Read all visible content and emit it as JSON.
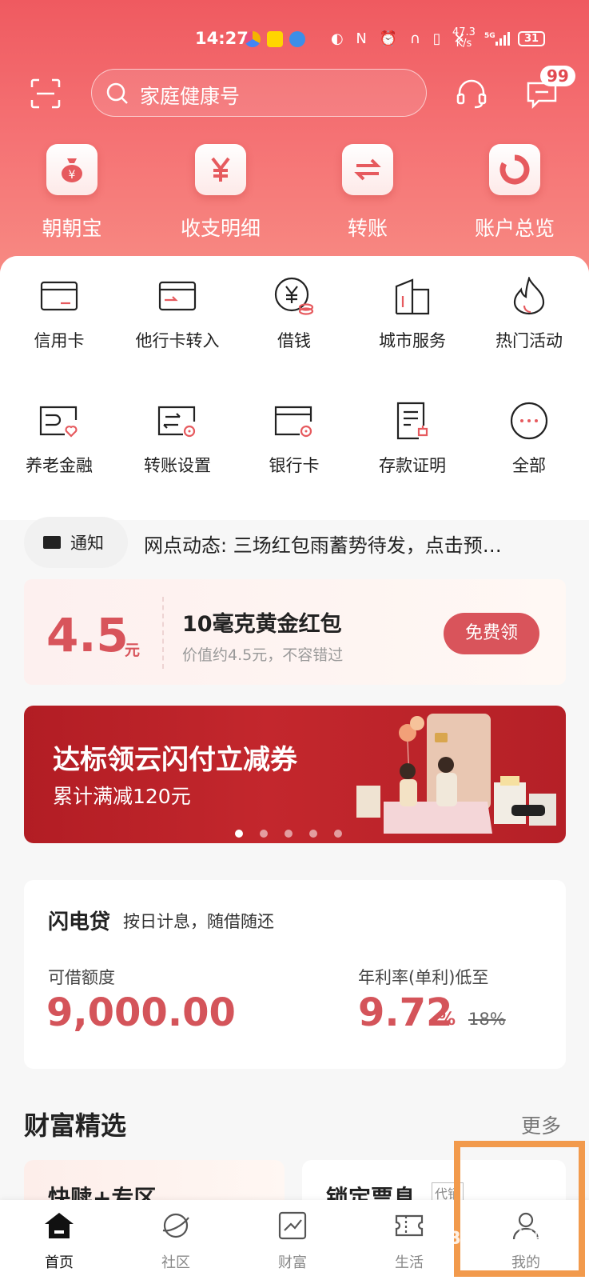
{
  "status_bar": {
    "time": "14:27",
    "network_speed_value": "47.3",
    "network_speed_unit": "K/s",
    "signal": "5G",
    "battery": "31"
  },
  "top_bar": {
    "search_placeholder": "家庭健康号",
    "message_badge": "99"
  },
  "quick_actions": [
    {
      "label": "朝朝宝",
      "icon": "money-bag-icon"
    },
    {
      "label": "收支明细",
      "icon": "yen-icon"
    },
    {
      "label": "转账",
      "icon": "transfer-arrows-icon"
    },
    {
      "label": "账户总览",
      "icon": "donut-chart-icon"
    }
  ],
  "services": [
    {
      "label": "信用卡",
      "icon": "credit-card-icon"
    },
    {
      "label": "他行卡转入",
      "icon": "card-transfer-in-icon"
    },
    {
      "label": "借钱",
      "icon": "yen-coin-icon"
    },
    {
      "label": "城市服务",
      "icon": "city-building-icon"
    },
    {
      "label": "热门活动",
      "icon": "flame-icon"
    },
    {
      "label": "养老金融",
      "icon": "pension-card-icon"
    },
    {
      "label": "转账设置",
      "icon": "transfer-settings-icon"
    },
    {
      "label": "银行卡",
      "icon": "bank-card-icon"
    },
    {
      "label": "存款证明",
      "icon": "deposit-certificate-icon"
    },
    {
      "label": "全部",
      "icon": "more-dots-icon"
    }
  ],
  "notice": {
    "label": "通知",
    "text": "网点动态: 三场红包雨蓄势待发，点击预…"
  },
  "gold_offer": {
    "amount": "4.5",
    "unit": "元",
    "title": "10毫克黄金红包",
    "subtitle": "价值约4.5元，不容错过",
    "button": "免费领"
  },
  "banner": {
    "title": "达标领云闪付立减券",
    "subtitle": "累计满减120元",
    "dot_count": 5,
    "active_dot": 0
  },
  "loan": {
    "title": "闪电贷",
    "subtitle": "按日计息，随借随还",
    "limit_label": "可借额度",
    "limit_value": "9,000.00",
    "rate_label": "年利率(单利)低至",
    "rate_value": "9.72",
    "rate_unit": "%",
    "old_rate": "18%"
  },
  "wealth": {
    "title": "财富精选",
    "more": "更多",
    "cards": [
      {
        "title": "快赎+专区"
      },
      {
        "title": "锁定票息",
        "tag": "代销"
      }
    ]
  },
  "tab_bar": {
    "tabs": [
      {
        "label": "首页",
        "icon": "home-icon",
        "active": true
      },
      {
        "label": "社区",
        "icon": "planet-icon",
        "active": false
      },
      {
        "label": "财富",
        "icon": "trend-chart-icon",
        "active": false
      },
      {
        "label": "生活",
        "icon": "ticket-icon",
        "active": false
      },
      {
        "label": "我的",
        "icon": "user-icon",
        "active": false
      }
    ]
  },
  "colors": {
    "brand_red": "#d9545b",
    "header_gradient_start": "#ef5a60",
    "highlight_orange": "#f29a4c"
  }
}
